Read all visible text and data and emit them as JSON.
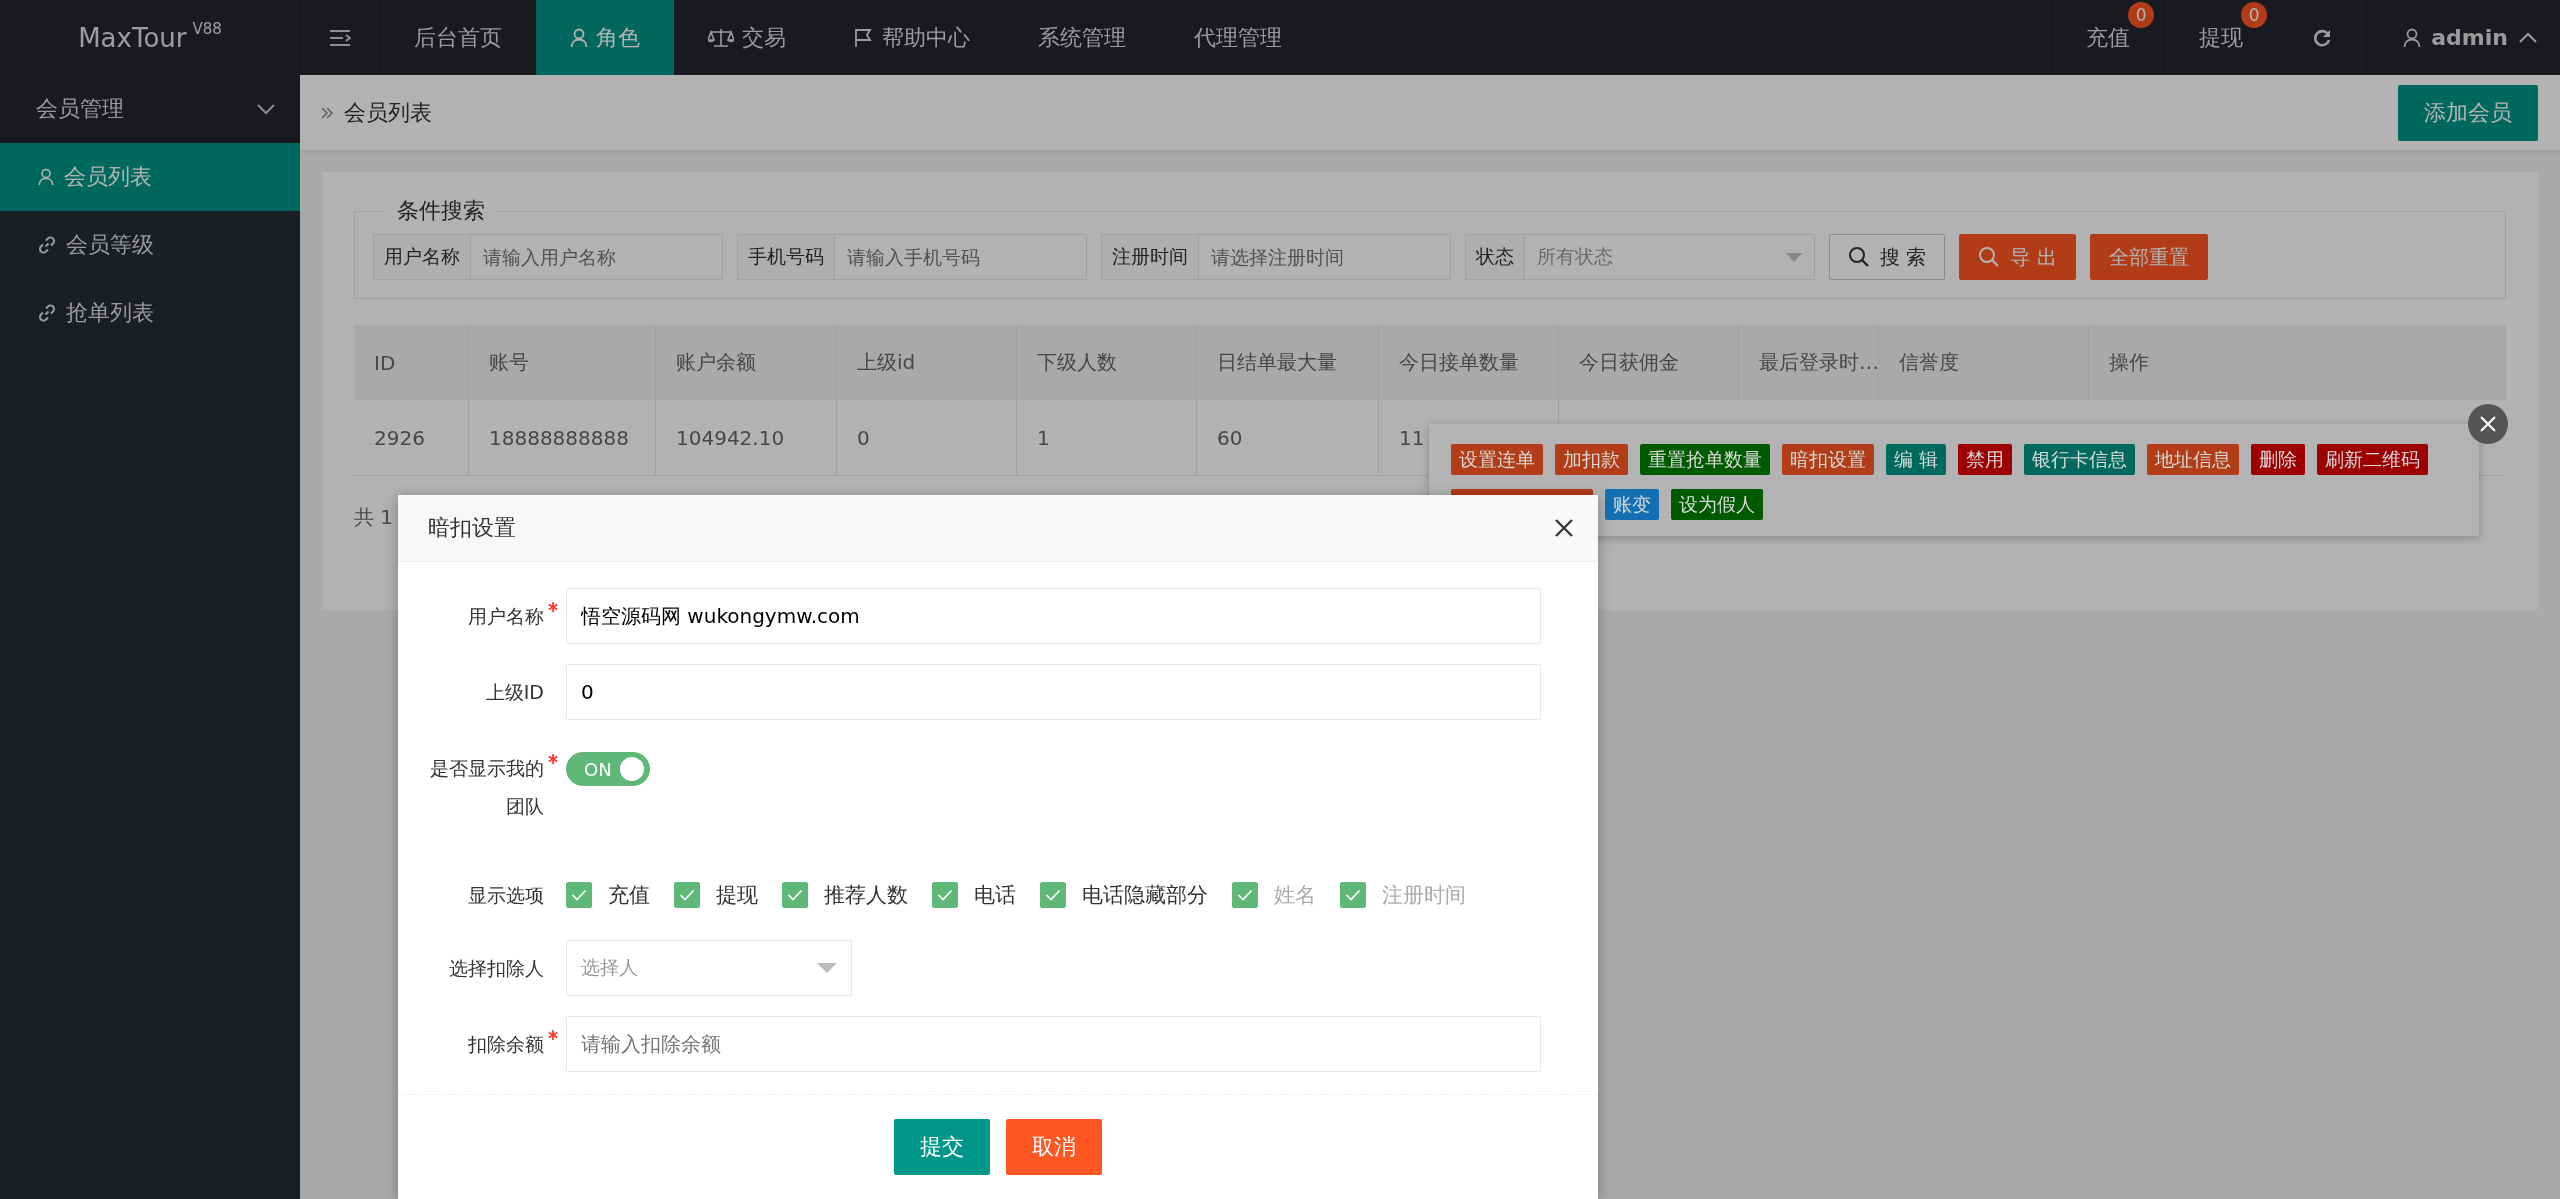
{
  "brand": {
    "name": "MaxTour",
    "version": "V88"
  },
  "top_nav": [
    {
      "label": "后台首页",
      "selected": false
    },
    {
      "label": "角色",
      "selected": true
    },
    {
      "label": "交易",
      "selected": false
    },
    {
      "label": "帮助中心",
      "selected": false
    },
    {
      "label": "系统管理",
      "selected": false
    },
    {
      "label": "代理管理",
      "selected": false
    }
  ],
  "top_right": {
    "recharge": {
      "label": "充值",
      "badge": "0"
    },
    "withdraw": {
      "label": "提现",
      "badge": "0"
    },
    "user": "admin"
  },
  "sidebar": {
    "group": {
      "label": "会员管理",
      "expanded": true
    },
    "items": [
      {
        "label": "会员列表",
        "selected": true
      },
      {
        "label": "会员等级",
        "selected": false
      },
      {
        "label": "抢单列表",
        "selected": false
      }
    ]
  },
  "breadcrumb": "会员列表",
  "add_button": "添加会员",
  "search": {
    "legend": "条件搜索",
    "fields": [
      {
        "kind": "text",
        "label": "用户名称",
        "placeholder": "请输入用户名称"
      },
      {
        "kind": "text",
        "label": "手机号码",
        "placeholder": "请输入手机号码"
      },
      {
        "kind": "text",
        "label": "注册时间",
        "placeholder": "请选择注册时间"
      },
      {
        "kind": "select",
        "label": "状态",
        "placeholder": "所有状态"
      }
    ],
    "buttons": [
      {
        "kind": "outline",
        "label": "搜 索"
      },
      {
        "kind": "warm",
        "label": "导 出"
      },
      {
        "kind": "warm",
        "label": "全部重置"
      }
    ]
  },
  "table": {
    "columns": [
      "ID",
      "账号",
      "账户余额",
      "上级id",
      "下级人数",
      "日结单最大量",
      "今日接单数量",
      "今日获佣金",
      "最后登录时…",
      "信誉度",
      "操作"
    ],
    "rows": [
      {
        "cells": [
          "2926",
          "18888888888",
          "104942.10",
          "0",
          "1",
          "60",
          "11"
        ]
      }
    ],
    "footer": "共 1"
  },
  "actions": [
    {
      "label": "设置连单",
      "color": "#b33d18"
    },
    {
      "label": "加扣款",
      "color": "#b33d18"
    },
    {
      "label": "重置抢单数量",
      "color": "#005a00"
    },
    {
      "label": "暗扣设置",
      "color": "#b33d18"
    },
    {
      "label": "编 辑",
      "color": "#00695f"
    },
    {
      "label": "禁用",
      "color": "#9d0000"
    },
    {
      "label": "银行卡信息",
      "color": "#00695f"
    },
    {
      "label": "地址信息",
      "color": "#b33d18"
    },
    {
      "label": "删除",
      "color": "#9d0000"
    },
    {
      "label": "刷新二维码",
      "color": "#9d0000"
    },
    {
      "color": "#b33d18"
    },
    {
      "label": "账变",
      "color": "#156fb3"
    },
    {
      "label": "设为假人",
      "color": "#005a00"
    }
  ],
  "modal": {
    "title": "暗扣设置",
    "fields": [
      {
        "kind": "text",
        "label": "用户名称",
        "required": true,
        "value": "悟空源码网 wukongymw.com"
      },
      {
        "kind": "text",
        "label": "上级ID",
        "required": false,
        "value": "0"
      },
      {
        "kind": "switch",
        "label": "是否显示我的团队",
        "required": true,
        "on": true,
        "text": "ON"
      },
      {
        "kind": "checks",
        "label": "显示选项",
        "required": false,
        "options": [
          {
            "label": "充值",
            "checked": true,
            "disabled": false
          },
          {
            "label": "提现",
            "checked": true,
            "disabled": false
          },
          {
            "label": "推荐人数",
            "checked": true,
            "disabled": false
          },
          {
            "label": "电话",
            "checked": true,
            "disabled": false
          },
          {
            "label": "电话隐藏部分",
            "checked": true,
            "disabled": false
          },
          {
            "label": "姓名",
            "checked": true,
            "disabled": true
          },
          {
            "label": "注册时间",
            "checked": true,
            "disabled": true
          }
        ]
      },
      {
        "kind": "select",
        "label": "选择扣除人",
        "required": false,
        "placeholder": "选择人"
      },
      {
        "kind": "text",
        "label": "扣除余额",
        "required": true,
        "placeholder": "请输入扣除余额"
      }
    ],
    "buttons": [
      {
        "kind": "primary",
        "label": "提交"
      },
      {
        "kind": "danger",
        "label": "取消"
      }
    ]
  }
}
